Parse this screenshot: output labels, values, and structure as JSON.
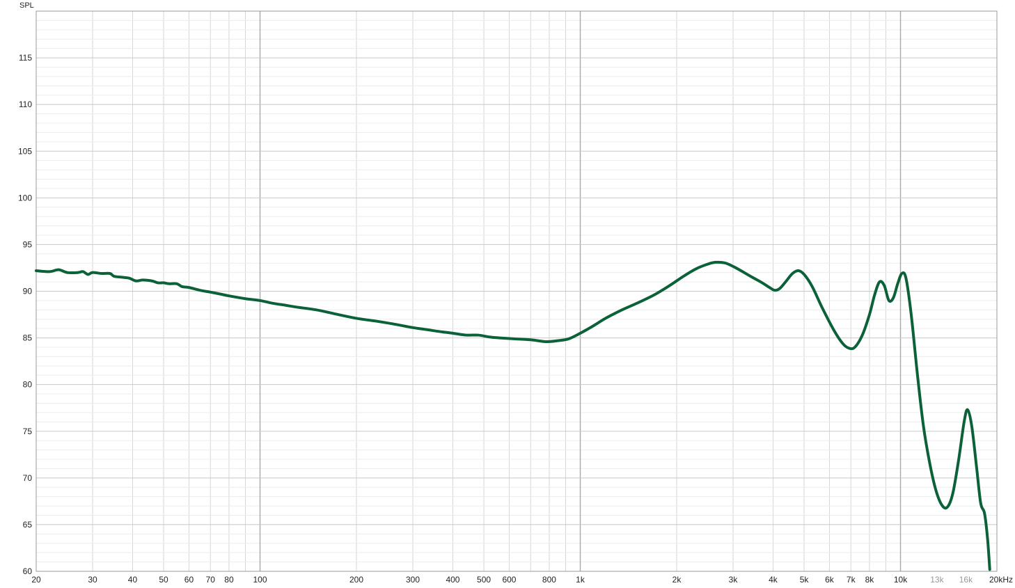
{
  "chart_data": {
    "type": "line",
    "ylabel": "SPL",
    "x_scale": "log",
    "xlim": [
      20,
      20000
    ],
    "ylim": [
      60,
      120
    ],
    "grid": true,
    "y_ticks": [
      {
        "value": 60,
        "label": "60"
      },
      {
        "value": 65,
        "label": "65"
      },
      {
        "value": 70,
        "label": "70"
      },
      {
        "value": 75,
        "label": "75"
      },
      {
        "value": 80,
        "label": "80"
      },
      {
        "value": 85,
        "label": "85"
      },
      {
        "value": 90,
        "label": "90"
      },
      {
        "value": 95,
        "label": "95"
      },
      {
        "value": 100,
        "label": "100"
      },
      {
        "value": 105,
        "label": "105"
      },
      {
        "value": 110,
        "label": "110"
      },
      {
        "value": 115,
        "label": "115"
      }
    ],
    "x_ticks": [
      {
        "value": 20,
        "label": "20"
      },
      {
        "value": 30,
        "label": "30"
      },
      {
        "value": 40,
        "label": "40"
      },
      {
        "value": 50,
        "label": "50"
      },
      {
        "value": 60,
        "label": "60"
      },
      {
        "value": 70,
        "label": "70"
      },
      {
        "value": 80,
        "label": "80"
      },
      {
        "value": 100,
        "label": "100"
      },
      {
        "value": 200,
        "label": "200"
      },
      {
        "value": 300,
        "label": "300"
      },
      {
        "value": 400,
        "label": "400"
      },
      {
        "value": 500,
        "label": "500"
      },
      {
        "value": 600,
        "label": "600"
      },
      {
        "value": 800,
        "label": "800"
      },
      {
        "value": 1000,
        "label": "1k"
      },
      {
        "value": 2000,
        "label": "2k"
      },
      {
        "value": 3000,
        "label": "3k"
      },
      {
        "value": 4000,
        "label": "4k"
      },
      {
        "value": 5000,
        "label": "5k"
      },
      {
        "value": 6000,
        "label": "6k"
      },
      {
        "value": 7000,
        "label": "7k"
      },
      {
        "value": 8000,
        "label": "8k"
      },
      {
        "value": 10000,
        "label": "10k"
      },
      {
        "value": 13000,
        "label": "13k",
        "dim": true
      },
      {
        "value": 16000,
        "label": "16k",
        "dim": true
      },
      {
        "value": 20000,
        "label": "20kHz"
      }
    ],
    "series": [
      {
        "color": "#0b6138",
        "points": [
          [
            20,
            92.2
          ],
          [
            22,
            92.1
          ],
          [
            23.5,
            92.3
          ],
          [
            25,
            92.0
          ],
          [
            27,
            92.0
          ],
          [
            28,
            92.1
          ],
          [
            29,
            91.8
          ],
          [
            30,
            92.0
          ],
          [
            32,
            91.9
          ],
          [
            34,
            91.9
          ],
          [
            35,
            91.6
          ],
          [
            37,
            91.5
          ],
          [
            39,
            91.4
          ],
          [
            41,
            91.1
          ],
          [
            43,
            91.2
          ],
          [
            46,
            91.1
          ],
          [
            48,
            90.9
          ],
          [
            50,
            90.9
          ],
          [
            52,
            90.8
          ],
          [
            55,
            90.8
          ],
          [
            57,
            90.5
          ],
          [
            60,
            90.4
          ],
          [
            65,
            90.1
          ],
          [
            70,
            89.9
          ],
          [
            75,
            89.7
          ],
          [
            80,
            89.5
          ],
          [
            90,
            89.2
          ],
          [
            100,
            89.0
          ],
          [
            110,
            88.7
          ],
          [
            120,
            88.5
          ],
          [
            130,
            88.3
          ],
          [
            150,
            88.0
          ],
          [
            170,
            87.6
          ],
          [
            200,
            87.1
          ],
          [
            230,
            86.8
          ],
          [
            260,
            86.5
          ],
          [
            300,
            86.1
          ],
          [
            330,
            85.9
          ],
          [
            360,
            85.7
          ],
          [
            400,
            85.5
          ],
          [
            440,
            85.3
          ],
          [
            480,
            85.3
          ],
          [
            520,
            85.1
          ],
          [
            560,
            85.0
          ],
          [
            620,
            84.9
          ],
          [
            700,
            84.8
          ],
          [
            780,
            84.6
          ],
          [
            850,
            84.7
          ],
          [
            920,
            84.9
          ],
          [
            1000,
            85.5
          ],
          [
            1100,
            86.3
          ],
          [
            1200,
            87.1
          ],
          [
            1350,
            88.0
          ],
          [
            1500,
            88.7
          ],
          [
            1700,
            89.6
          ],
          [
            1900,
            90.6
          ],
          [
            2100,
            91.6
          ],
          [
            2300,
            92.4
          ],
          [
            2500,
            92.9
          ],
          [
            2650,
            93.1
          ],
          [
            2850,
            93.0
          ],
          [
            3100,
            92.4
          ],
          [
            3400,
            91.6
          ],
          [
            3700,
            90.9
          ],
          [
            3900,
            90.4
          ],
          [
            4050,
            90.1
          ],
          [
            4200,
            90.3
          ],
          [
            4400,
            91.1
          ],
          [
            4600,
            91.9
          ],
          [
            4800,
            92.2
          ],
          [
            5000,
            91.8
          ],
          [
            5300,
            90.5
          ],
          [
            5700,
            88.2
          ],
          [
            6200,
            85.8
          ],
          [
            6600,
            84.4
          ],
          [
            6900,
            83.9
          ],
          [
            7200,
            84.0
          ],
          [
            7600,
            85.3
          ],
          [
            8000,
            87.5
          ],
          [
            8300,
            89.6
          ],
          [
            8600,
            91.0
          ],
          [
            8900,
            90.6
          ],
          [
            9200,
            89.0
          ],
          [
            9500,
            89.3
          ],
          [
            9800,
            90.8
          ],
          [
            10100,
            91.9
          ],
          [
            10400,
            91.4
          ],
          [
            10800,
            87.5
          ],
          [
            11300,
            81.0
          ],
          [
            11800,
            75.5
          ],
          [
            12400,
            71.2
          ],
          [
            13000,
            68.3
          ],
          [
            13600,
            66.9
          ],
          [
            14100,
            67.0
          ],
          [
            14600,
            68.5
          ],
          [
            15200,
            72.0
          ],
          [
            15800,
            76.0
          ],
          [
            16200,
            77.3
          ],
          [
            16700,
            75.5
          ],
          [
            17300,
            71.0
          ],
          [
            17800,
            67.3
          ],
          [
            18300,
            66.2
          ],
          [
            18700,
            63.5
          ],
          [
            19000,
            60.2
          ]
        ]
      }
    ]
  }
}
